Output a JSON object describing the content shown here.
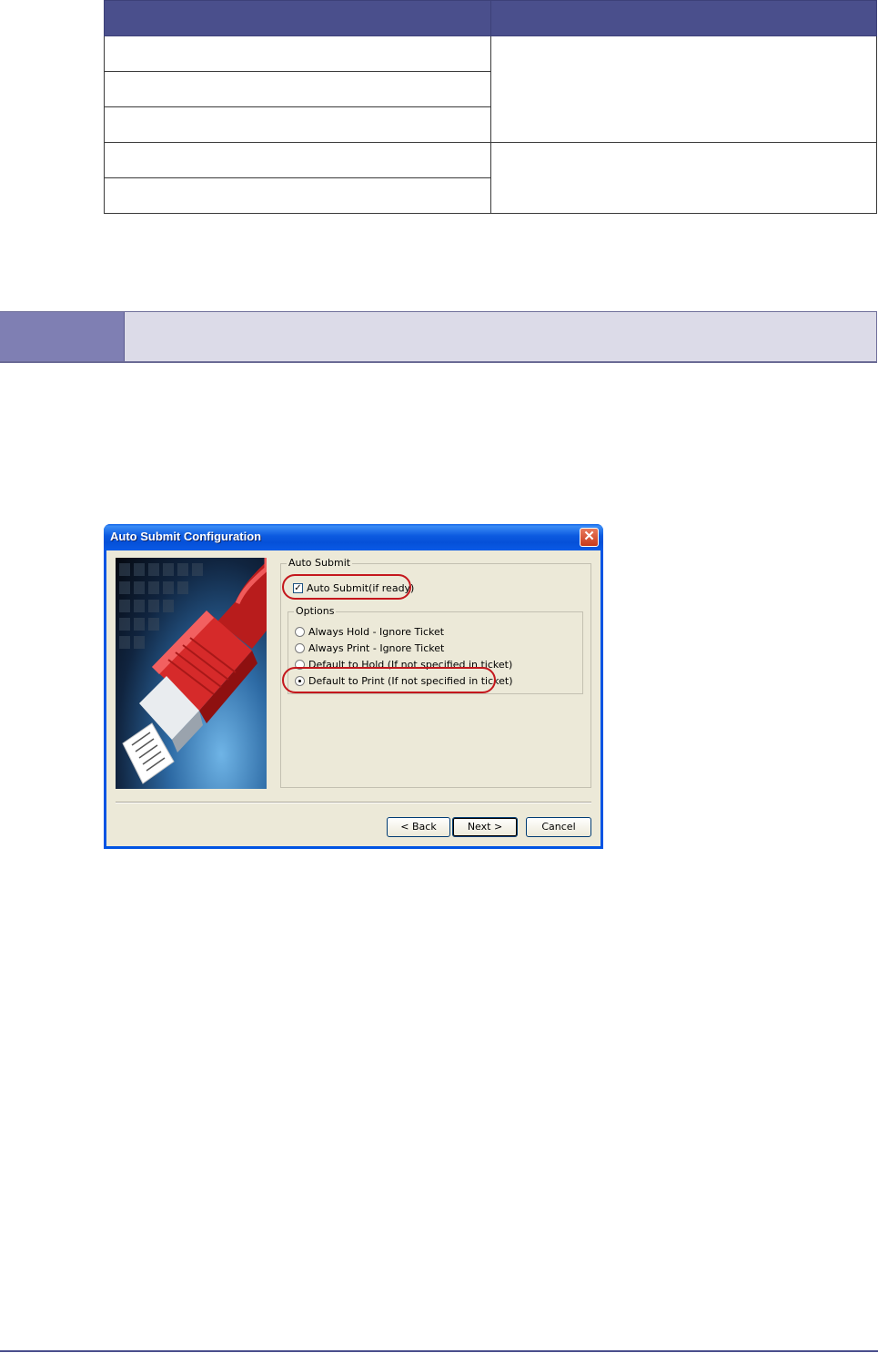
{
  "dialog": {
    "title": "Auto Submit Configuration",
    "close_symbol": "✕",
    "auto_submit_group": "Auto Submit",
    "auto_submit_checkbox": "Auto Submit(if ready)",
    "auto_submit_checked": true,
    "options_group": "Options",
    "options": [
      {
        "label": "Always Hold - Ignore Ticket",
        "selected": false
      },
      {
        "label": "Always Print - Ignore Ticket",
        "selected": false
      },
      {
        "label": "Default to Hold (If not specified in ticket)",
        "selected": false
      },
      {
        "label": "Default to Print (If not specified in ticket)",
        "selected": true
      }
    ],
    "buttons": {
      "back": "< Back",
      "next": "Next >",
      "cancel": "Cancel"
    }
  },
  "colors": {
    "table_header": "#4a4f8c",
    "section_tab": "#7f7fb3",
    "section_fill": "#dcdbe8",
    "highlight_oval": "#c4171d",
    "dialog_face": "#ece9d8"
  },
  "icons": [
    "close-icon",
    "network-cable-illustration",
    "document-icon"
  ]
}
